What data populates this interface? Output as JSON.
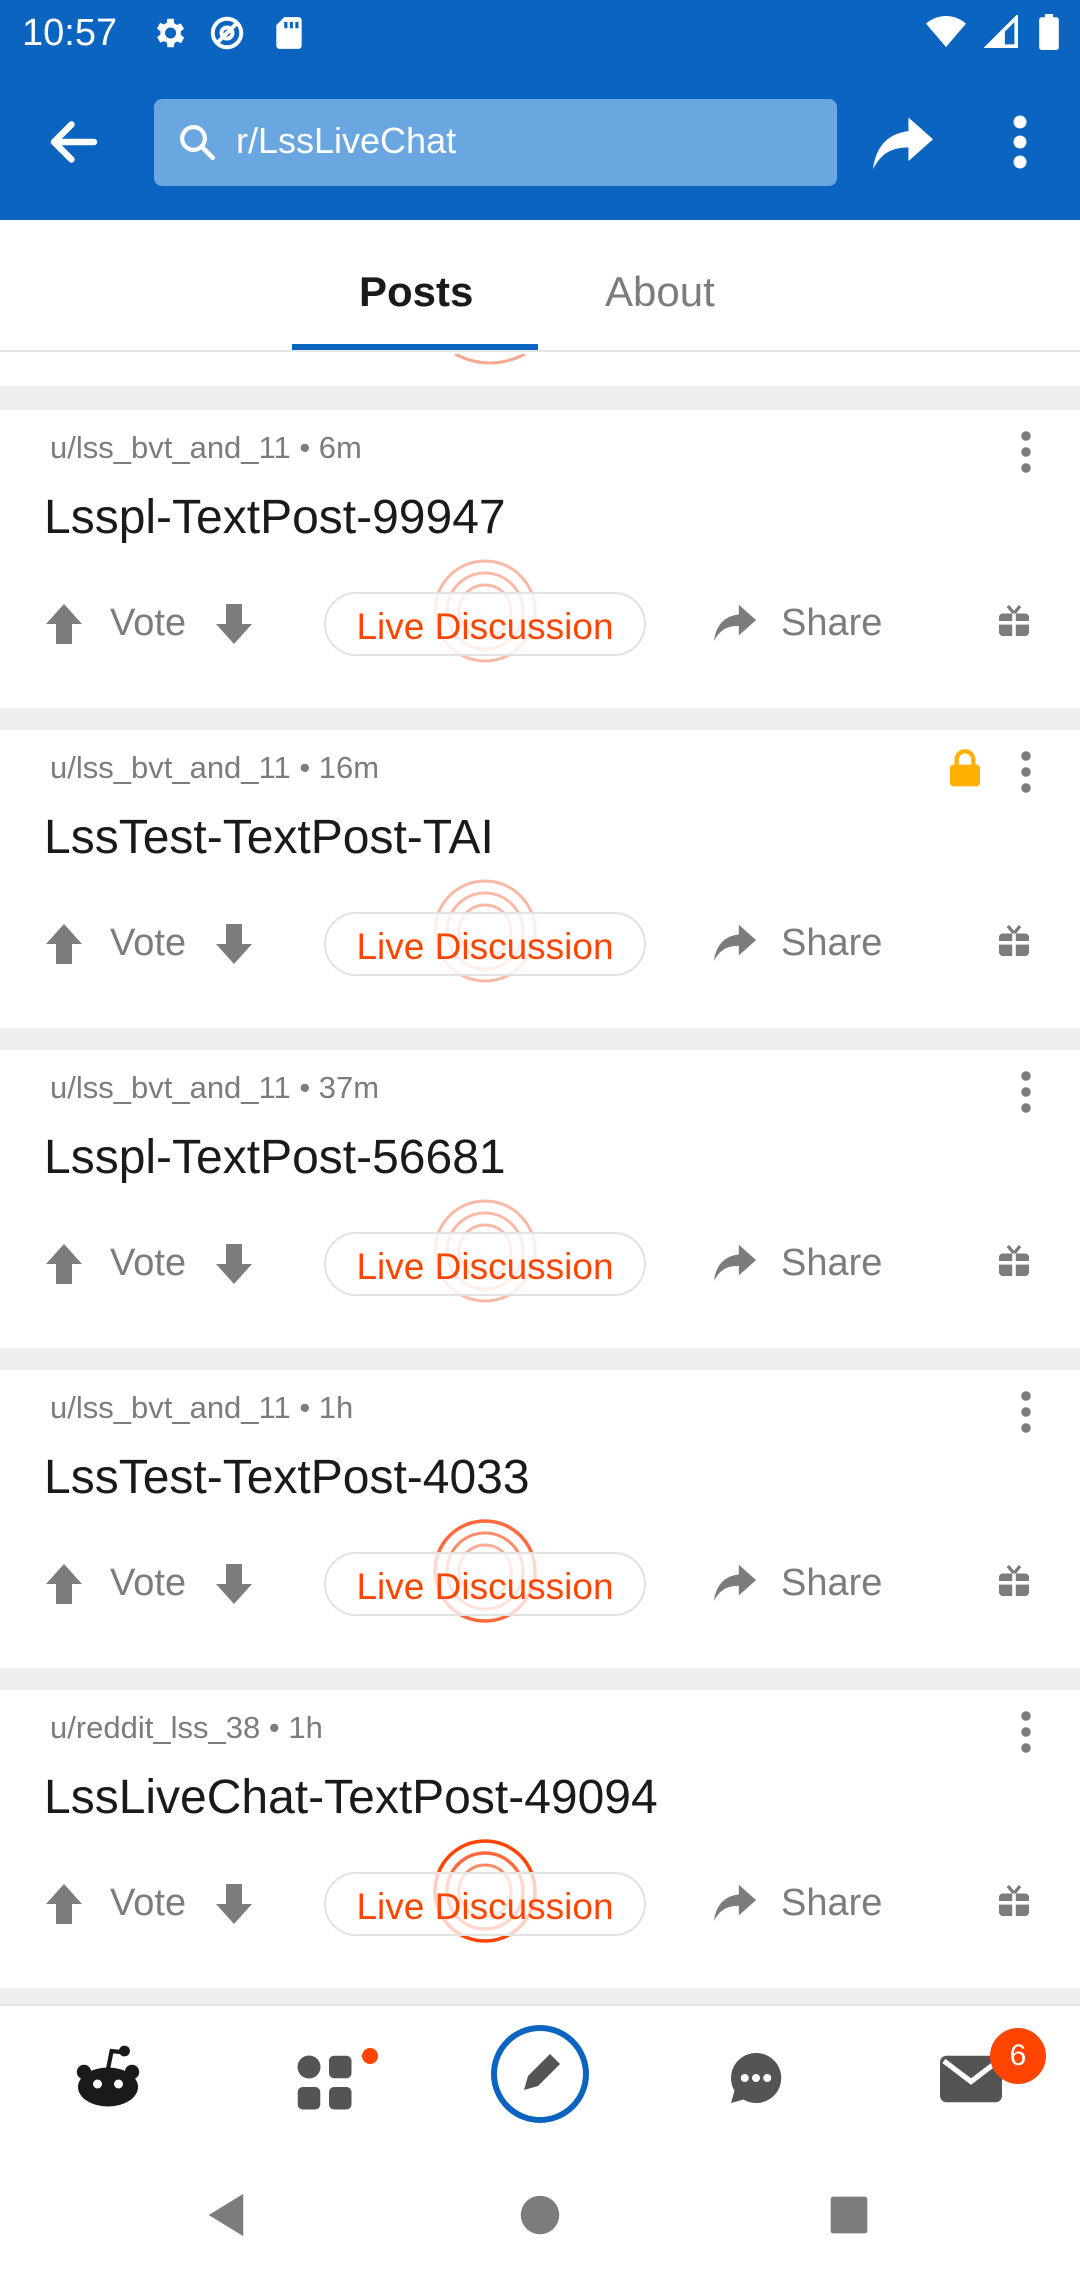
{
  "status_bar": {
    "time": "10:57"
  },
  "header": {
    "search_text": "r/LssLiveChat"
  },
  "tabs": [
    {
      "label": "Posts"
    },
    {
      "label": "About"
    }
  ],
  "posts": [
    {
      "meta": "u/lss_bvt_and_11 • 6m",
      "title": "Lsspl-TextPost-99947",
      "locked": false
    },
    {
      "meta": "u/lss_bvt_and_11 • 16m",
      "title": "LssTest-TextPost-TAI",
      "locked": true
    },
    {
      "meta": "u/lss_bvt_and_11 • 37m",
      "title": "Lsspl-TextPost-56681",
      "locked": false
    },
    {
      "meta": "u/lss_bvt_and_11 • 1h",
      "title": "LssTest-TextPost-4033",
      "locked": false
    },
    {
      "meta": "u/reddit_lss_38 • 1h",
      "title": "LssLiveChat-TextPost-49094",
      "locked": false
    }
  ],
  "actions": {
    "vote": "Vote",
    "live": "Live Discussion",
    "share": "Share"
  },
  "bottom_nav": {
    "inbox_badge": "6"
  },
  "colors": {
    "brand_blue": "#0b64c0",
    "live_orange": "#ff4500",
    "lock_gold": "#ffb000"
  }
}
